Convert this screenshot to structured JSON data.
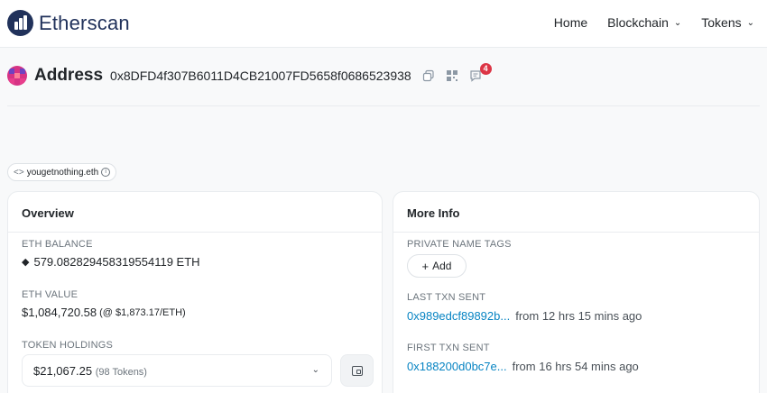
{
  "brand": {
    "name": "Etherscan"
  },
  "nav": {
    "home": "Home",
    "blockchain": "Blockchain",
    "tokens": "Tokens"
  },
  "address": {
    "label": "Address",
    "hash": "0x8DFD4f307B6011D4CB21007FD5658f0686523938",
    "notification_count": "4"
  },
  "ens": {
    "name": "yougetnothing.eth"
  },
  "overview": {
    "title": "Overview",
    "eth_balance_label": "ETH BALANCE",
    "eth_balance_value": "579.082829458319554119 ETH",
    "eth_value_label": "ETH VALUE",
    "eth_value_value": "$1,084,720.58",
    "eth_value_price": "(@ $1,873.17/ETH)",
    "token_holdings_label": "TOKEN HOLDINGS",
    "token_holdings_value": "$21,067.25",
    "token_holdings_count": "(98 Tokens)"
  },
  "more_info": {
    "title": "More Info",
    "private_tags_label": "PRIVATE NAME TAGS",
    "add_label": "Add",
    "last_txn_label": "LAST TXN SENT",
    "last_txn_hash": "0x989edcf89892b...",
    "last_txn_time": "from 12 hrs 15 mins ago",
    "first_txn_label": "FIRST TXN SENT",
    "first_txn_hash": "0x188200d0bc7e...",
    "first_txn_time": "from 16 hrs 54 mins ago"
  },
  "icons": {
    "logo": "etherscan-logo-icon",
    "copy": "copy-icon",
    "qr": "qr-code-icon",
    "comment": "comment-icon",
    "eth": "ethereum-icon",
    "wallet": "wallet-icon"
  },
  "colors": {
    "brand_navy": "#21325b",
    "link_blue": "#0784c3",
    "badge_red": "#dc3545"
  }
}
